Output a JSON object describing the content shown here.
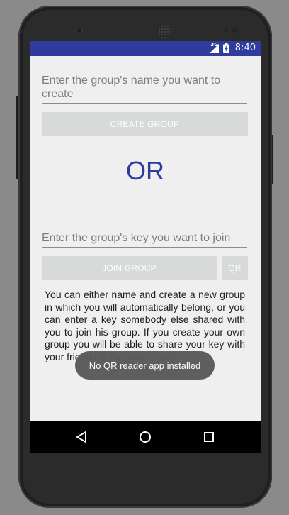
{
  "status_bar": {
    "network": "3G",
    "time": "8:40"
  },
  "create_section": {
    "name_placeholder": "Enter the group's name you want to create",
    "create_button_label": "CREATE GROUP"
  },
  "separator": {
    "text": "OR"
  },
  "join_section": {
    "key_placeholder": "Enter the group's key you want to join",
    "join_button_label": "JOIN GROUP",
    "qr_button_label": "QR"
  },
  "info_text": "You can either name and create a new group in which you will automatically belong, or you can enter a key somebody else shared with you to join his group. If you create your own group you will be able to share your key with your friends in the next screen.",
  "toast": {
    "message": "No QR reader app installed"
  },
  "nav_bar": {
    "icons": [
      "back-icon",
      "home-icon",
      "recents-icon"
    ]
  },
  "colors": {
    "accent": "#2f3c9e",
    "button_bg": "#d8d9d9",
    "screen_bg": "#efefef"
  }
}
